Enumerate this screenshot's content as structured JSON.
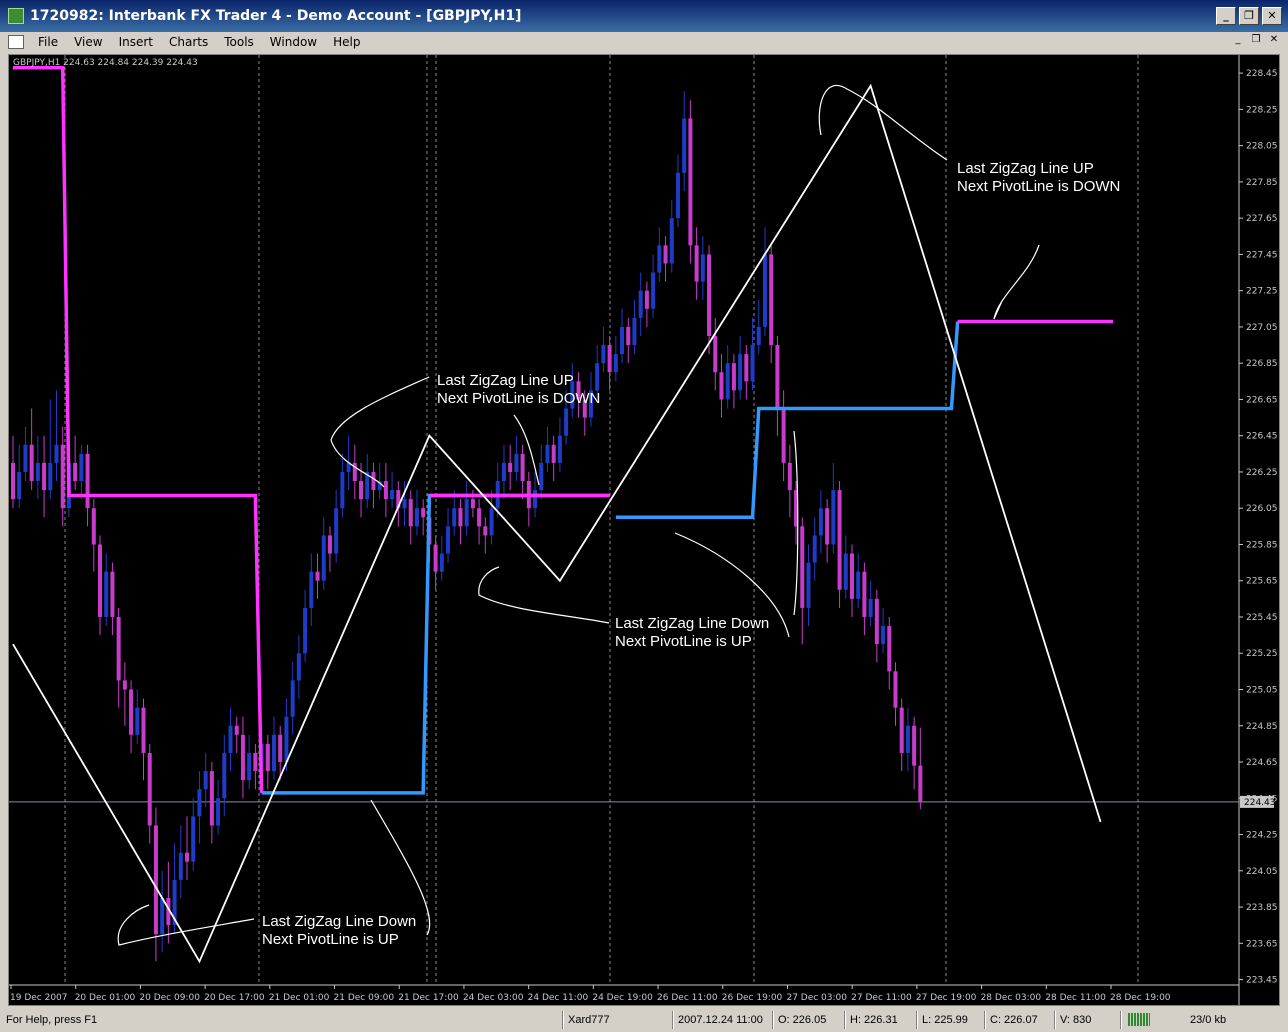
{
  "window": {
    "title": "1720982: Interbank FX Trader 4 - Demo Account - [GBPJPY,H1]",
    "buttons": {
      "minimize": "_",
      "restore": "❐",
      "close": "✕"
    }
  },
  "menu": {
    "items": [
      "File",
      "View",
      "Insert",
      "Charts",
      "Tools",
      "Window",
      "Help"
    ],
    "mdi": {
      "minimize": "_",
      "restore": "❐",
      "close": "✕"
    }
  },
  "chart": {
    "info": "GBPJPY,H1  224.63 224.84 224.39 224.43",
    "current_price": "224.43",
    "colors": {
      "background": "#000000",
      "bull": "#1e3cc8",
      "bear": "#c83ccc",
      "pivot_down": "#ff33ff",
      "pivot_up": "#3399ff",
      "zigzag": "#ffffff",
      "grid": "#888888"
    },
    "annotations": [
      {
        "line1": "Last ZigZag Line UP",
        "line2": "Next PivotLine is DOWN"
      },
      {
        "line1": "Last ZigZag Line UP",
        "line2": "Next PivotLine is DOWN"
      },
      {
        "line1": "Last ZigZag Line Down",
        "line2": "Next PivotLine is UP"
      },
      {
        "line1": "Last ZigZag Line Down",
        "line2": "Next PivotLine is UP"
      }
    ]
  },
  "chart_data": {
    "type": "candlestick",
    "symbol": "GBPJPY,H1",
    "y_ticks": [
      "228.45",
      "228.25",
      "228.05",
      "227.85",
      "227.65",
      "227.45",
      "227.25",
      "227.05",
      "226.85",
      "226.65",
      "226.45",
      "226.25",
      "226.05",
      "225.85",
      "225.65",
      "225.45",
      "225.25",
      "225.05",
      "224.85",
      "224.65",
      "224.45",
      "224.25",
      "224.05",
      "223.85",
      "223.65",
      "223.45"
    ],
    "ylim": [
      223.42,
      228.55
    ],
    "x_ticks": [
      "19 Dec 2007",
      "20 Dec 01:00",
      "20 Dec 09:00",
      "20 Dec 17:00",
      "21 Dec 01:00",
      "21 Dec 09:00",
      "21 Dec 17:00",
      "24 Dec 03:00",
      "24 Dec 11:00",
      "24 Dec 19:00",
      "26 Dec 11:00",
      "26 Dec 19:00",
      "27 Dec 03:00",
      "27 Dec 11:00",
      "27 Dec 19:00",
      "28 Dec 03:00",
      "28 Dec 11:00",
      "28 Dec 19:00"
    ],
    "zigzag": [
      {
        "bar": 0,
        "price": 225.3
      },
      {
        "bar": 30,
        "price": 223.55
      },
      {
        "bar": 67,
        "price": 226.45
      },
      {
        "bar": 88,
        "price": 225.65
      },
      {
        "bar": 138,
        "price": 228.38
      },
      {
        "bar": 175,
        "price": 224.32
      }
    ],
    "pivot_lines": [
      {
        "dir": "down",
        "points": [
          [
            0,
            228.48
          ],
          [
            8,
            228.48
          ],
          [
            9,
            226.12
          ],
          [
            39,
            226.12
          ],
          [
            40,
            224.48
          ]
        ]
      },
      {
        "dir": "up",
        "points": [
          [
            40,
            224.48
          ],
          [
            66,
            224.48
          ],
          [
            67,
            226.12
          ],
          [
            96,
            226.12
          ]
        ]
      },
      {
        "dir": "down",
        "points": [
          [
            67,
            226.12
          ],
          [
            96,
            226.12
          ]
        ]
      },
      {
        "dir": "up",
        "points": [
          [
            97,
            226.0
          ],
          [
            119,
            226.0
          ],
          [
            120,
            226.6
          ],
          [
            151,
            226.6
          ],
          [
            152,
            227.08
          ]
        ]
      },
      {
        "dir": "down",
        "points": [
          [
            152,
            227.08
          ],
          [
            177,
            227.08
          ]
        ]
      }
    ],
    "candles": [
      [
        226.3,
        226.1,
        226.45,
        226.05
      ],
      [
        226.1,
        226.25,
        226.4,
        226.05
      ],
      [
        226.25,
        226.4,
        226.5,
        226.2
      ],
      [
        226.4,
        226.2,
        226.6,
        226.15
      ],
      [
        226.2,
        226.3,
        226.45,
        226.1
      ],
      [
        226.3,
        226.15,
        226.45,
        226.0
      ],
      [
        226.15,
        226.3,
        226.65,
        226.1
      ],
      [
        226.3,
        226.4,
        226.7,
        226.2
      ],
      [
        226.4,
        226.05,
        226.5,
        225.95
      ],
      [
        226.05,
        226.3,
        226.4,
        226.0
      ],
      [
        226.3,
        226.2,
        226.45,
        226.15
      ],
      [
        226.2,
        226.35,
        226.4,
        226.1
      ],
      [
        226.35,
        226.05,
        226.4,
        225.95
      ],
      [
        226.05,
        225.85,
        226.1,
        225.7
      ],
      [
        225.85,
        225.45,
        225.9,
        225.35
      ],
      [
        225.45,
        225.7,
        225.8,
        225.4
      ],
      [
        225.7,
        225.45,
        225.75,
        225.35
      ],
      [
        225.45,
        225.1,
        225.5,
        224.95
      ],
      [
        225.1,
        225.05,
        225.2,
        224.85
      ],
      [
        225.05,
        224.8,
        225.1,
        224.7
      ],
      [
        224.8,
        224.95,
        225.05,
        224.75
      ],
      [
        224.95,
        224.7,
        225.0,
        224.55
      ],
      [
        224.7,
        224.3,
        224.75,
        224.2
      ],
      [
        224.3,
        223.7,
        224.4,
        223.55
      ],
      [
        223.7,
        223.9,
        224.05,
        223.6
      ],
      [
        223.9,
        223.75,
        224.1,
        223.65
      ],
      [
        223.75,
        224.0,
        224.2,
        223.7
      ],
      [
        224.0,
        224.15,
        224.3,
        223.9
      ],
      [
        224.15,
        224.1,
        224.35,
        224.0
      ],
      [
        224.1,
        224.35,
        224.45,
        224.05
      ],
      [
        224.35,
        224.5,
        224.6,
        224.2
      ],
      [
        224.5,
        224.6,
        224.7,
        224.4
      ],
      [
        224.6,
        224.3,
        224.65,
        224.2
      ],
      [
        224.3,
        224.45,
        224.55,
        224.25
      ],
      [
        224.45,
        224.7,
        224.8,
        224.35
      ],
      [
        224.7,
        224.85,
        224.95,
        224.6
      ],
      [
        224.85,
        224.8,
        224.9,
        224.7
      ],
      [
        224.8,
        224.55,
        224.9,
        224.45
      ],
      [
        224.55,
        224.7,
        224.8,
        224.5
      ],
      [
        224.7,
        224.6,
        224.75,
        224.5
      ],
      [
        224.6,
        224.75,
        224.85,
        224.55
      ],
      [
        224.75,
        224.6,
        224.8,
        224.5
      ],
      [
        224.6,
        224.8,
        224.9,
        224.55
      ],
      [
        224.8,
        224.65,
        224.85,
        224.55
      ],
      [
        224.65,
        224.9,
        225.0,
        224.6
      ],
      [
        224.9,
        225.1,
        225.2,
        224.8
      ],
      [
        225.1,
        225.25,
        225.35,
        225.0
      ],
      [
        225.25,
        225.5,
        225.6,
        225.2
      ],
      [
        225.5,
        225.7,
        225.8,
        225.4
      ],
      [
        225.7,
        225.65,
        225.8,
        225.55
      ],
      [
        225.65,
        225.9,
        226.0,
        225.6
      ],
      [
        225.9,
        225.8,
        225.95,
        225.7
      ],
      [
        225.8,
        226.05,
        226.15,
        225.75
      ],
      [
        226.05,
        226.25,
        226.35,
        226.0
      ],
      [
        226.25,
        226.3,
        226.45,
        226.15
      ],
      [
        226.3,
        226.2,
        226.4,
        226.1
      ],
      [
        226.2,
        226.1,
        226.3,
        226.0
      ],
      [
        226.1,
        226.25,
        226.35,
        226.05
      ],
      [
        226.25,
        226.15,
        226.3,
        226.05
      ],
      [
        226.15,
        226.2,
        226.3,
        226.1
      ],
      [
        226.2,
        226.1,
        226.3,
        226.0
      ],
      [
        226.1,
        226.15,
        226.25,
        226.05
      ],
      [
        226.15,
        226.05,
        226.2,
        225.95
      ],
      [
        226.05,
        226.1,
        226.2,
        225.95
      ],
      [
        226.1,
        225.95,
        226.15,
        225.85
      ],
      [
        225.95,
        226.05,
        226.15,
        225.9
      ],
      [
        226.05,
        226.0,
        226.1,
        225.9
      ],
      [
        226.0,
        225.85,
        226.05,
        225.75
      ],
      [
        225.85,
        225.7,
        225.9,
        225.6
      ],
      [
        225.7,
        225.8,
        225.9,
        225.65
      ],
      [
        225.8,
        225.95,
        226.05,
        225.75
      ],
      [
        225.95,
        226.05,
        226.15,
        225.9
      ],
      [
        226.05,
        225.95,
        226.1,
        225.85
      ],
      [
        225.95,
        226.1,
        226.2,
        225.9
      ],
      [
        226.1,
        226.05,
        226.15,
        226.0
      ],
      [
        226.05,
        225.95,
        226.1,
        225.85
      ],
      [
        225.95,
        225.9,
        226.0,
        225.8
      ],
      [
        225.9,
        226.05,
        226.15,
        225.85
      ],
      [
        226.05,
        226.2,
        226.3,
        226.0
      ],
      [
        226.2,
        226.3,
        226.4,
        226.1
      ],
      [
        226.3,
        226.25,
        226.4,
        226.15
      ],
      [
        226.25,
        226.35,
        226.45,
        226.2
      ],
      [
        226.35,
        226.2,
        226.4,
        226.1
      ],
      [
        226.2,
        226.05,
        226.25,
        225.95
      ],
      [
        226.05,
        226.15,
        226.25,
        226.0
      ],
      [
        226.15,
        226.3,
        226.4,
        226.1
      ],
      [
        226.3,
        226.4,
        226.5,
        226.25
      ],
      [
        226.4,
        226.3,
        226.45,
        226.2
      ],
      [
        226.3,
        226.45,
        226.55,
        226.25
      ],
      [
        226.45,
        226.6,
        226.7,
        226.4
      ],
      [
        226.6,
        226.75,
        226.85,
        226.55
      ],
      [
        226.75,
        226.65,
        226.8,
        226.55
      ],
      [
        226.65,
        226.55,
        226.7,
        226.45
      ],
      [
        226.55,
        226.7,
        226.8,
        226.5
      ],
      [
        226.7,
        226.85,
        226.95,
        226.65
      ],
      [
        226.85,
        226.95,
        227.05,
        226.8
      ],
      [
        226.95,
        226.8,
        227.0,
        226.7
      ],
      [
        226.8,
        226.9,
        227.0,
        226.75
      ],
      [
        226.9,
        227.05,
        227.15,
        226.85
      ],
      [
        227.05,
        226.95,
        227.1,
        226.85
      ],
      [
        226.95,
        227.1,
        227.2,
        226.9
      ],
      [
        227.1,
        227.25,
        227.35,
        227.0
      ],
      [
        227.25,
        227.15,
        227.3,
        227.05
      ],
      [
        227.15,
        227.35,
        227.45,
        227.1
      ],
      [
        227.35,
        227.5,
        227.6,
        227.3
      ],
      [
        227.5,
        227.4,
        227.55,
        227.3
      ],
      [
        227.4,
        227.65,
        227.75,
        227.35
      ],
      [
        227.65,
        227.9,
        228.0,
        227.6
      ],
      [
        227.9,
        228.2,
        228.35,
        227.8
      ],
      [
        228.2,
        227.5,
        228.3,
        227.4
      ],
      [
        227.5,
        227.3,
        227.6,
        227.2
      ],
      [
        227.3,
        227.45,
        227.55,
        227.2
      ],
      [
        227.45,
        227.0,
        227.5,
        226.9
      ],
      [
        227.0,
        226.8,
        227.1,
        226.7
      ],
      [
        226.8,
        226.65,
        226.9,
        226.55
      ],
      [
        226.65,
        226.85,
        226.95,
        226.6
      ],
      [
        226.85,
        226.7,
        226.9,
        226.6
      ],
      [
        226.7,
        226.9,
        227.0,
        226.65
      ],
      [
        226.9,
        226.75,
        226.95,
        226.65
      ],
      [
        226.75,
        226.95,
        227.1,
        226.7
      ],
      [
        226.95,
        227.05,
        227.2,
        226.9
      ],
      [
        227.05,
        227.45,
        227.6,
        227.0
      ],
      [
        227.45,
        226.95,
        227.5,
        226.85
      ],
      [
        226.95,
        226.6,
        227.0,
        226.45
      ],
      [
        226.6,
        226.3,
        226.7,
        226.2
      ],
      [
        226.3,
        226.15,
        226.4,
        226.0
      ],
      [
        226.15,
        225.95,
        226.2,
        225.85
      ],
      [
        225.95,
        225.5,
        226.0,
        225.3
      ],
      [
        225.5,
        225.75,
        225.85,
        225.4
      ],
      [
        225.75,
        225.9,
        226.0,
        225.65
      ],
      [
        225.9,
        226.05,
        226.15,
        225.8
      ],
      [
        226.05,
        225.85,
        226.1,
        225.75
      ],
      [
        225.85,
        226.15,
        226.3,
        225.8
      ],
      [
        226.15,
        225.6,
        226.2,
        225.5
      ],
      [
        225.6,
        225.8,
        225.9,
        225.55
      ],
      [
        225.8,
        225.55,
        225.85,
        225.45
      ],
      [
        225.55,
        225.7,
        225.8,
        225.5
      ],
      [
        225.7,
        225.45,
        225.75,
        225.35
      ],
      [
        225.45,
        225.55,
        225.65,
        225.4
      ],
      [
        225.55,
        225.3,
        225.6,
        225.2
      ],
      [
        225.3,
        225.4,
        225.5,
        225.25
      ],
      [
        225.4,
        225.15,
        225.45,
        225.05
      ],
      [
        225.15,
        224.95,
        225.2,
        224.85
      ],
      [
        224.95,
        224.7,
        225.0,
        224.6
      ],
      [
        224.7,
        224.85,
        224.95,
        224.6
      ],
      [
        224.85,
        224.63,
        224.9,
        224.5
      ],
      [
        224.63,
        224.43,
        224.84,
        224.39
      ]
    ]
  },
  "statusbar": {
    "help": "For Help, press F1",
    "profile": "Xard777",
    "datetime": "2007.12.24 11:00",
    "open": "O: 226.05",
    "high": "H: 226.31",
    "low": "L: 225.99",
    "close": "C: 226.07",
    "volume": "V: 830",
    "traffic": "23/0 kb"
  }
}
